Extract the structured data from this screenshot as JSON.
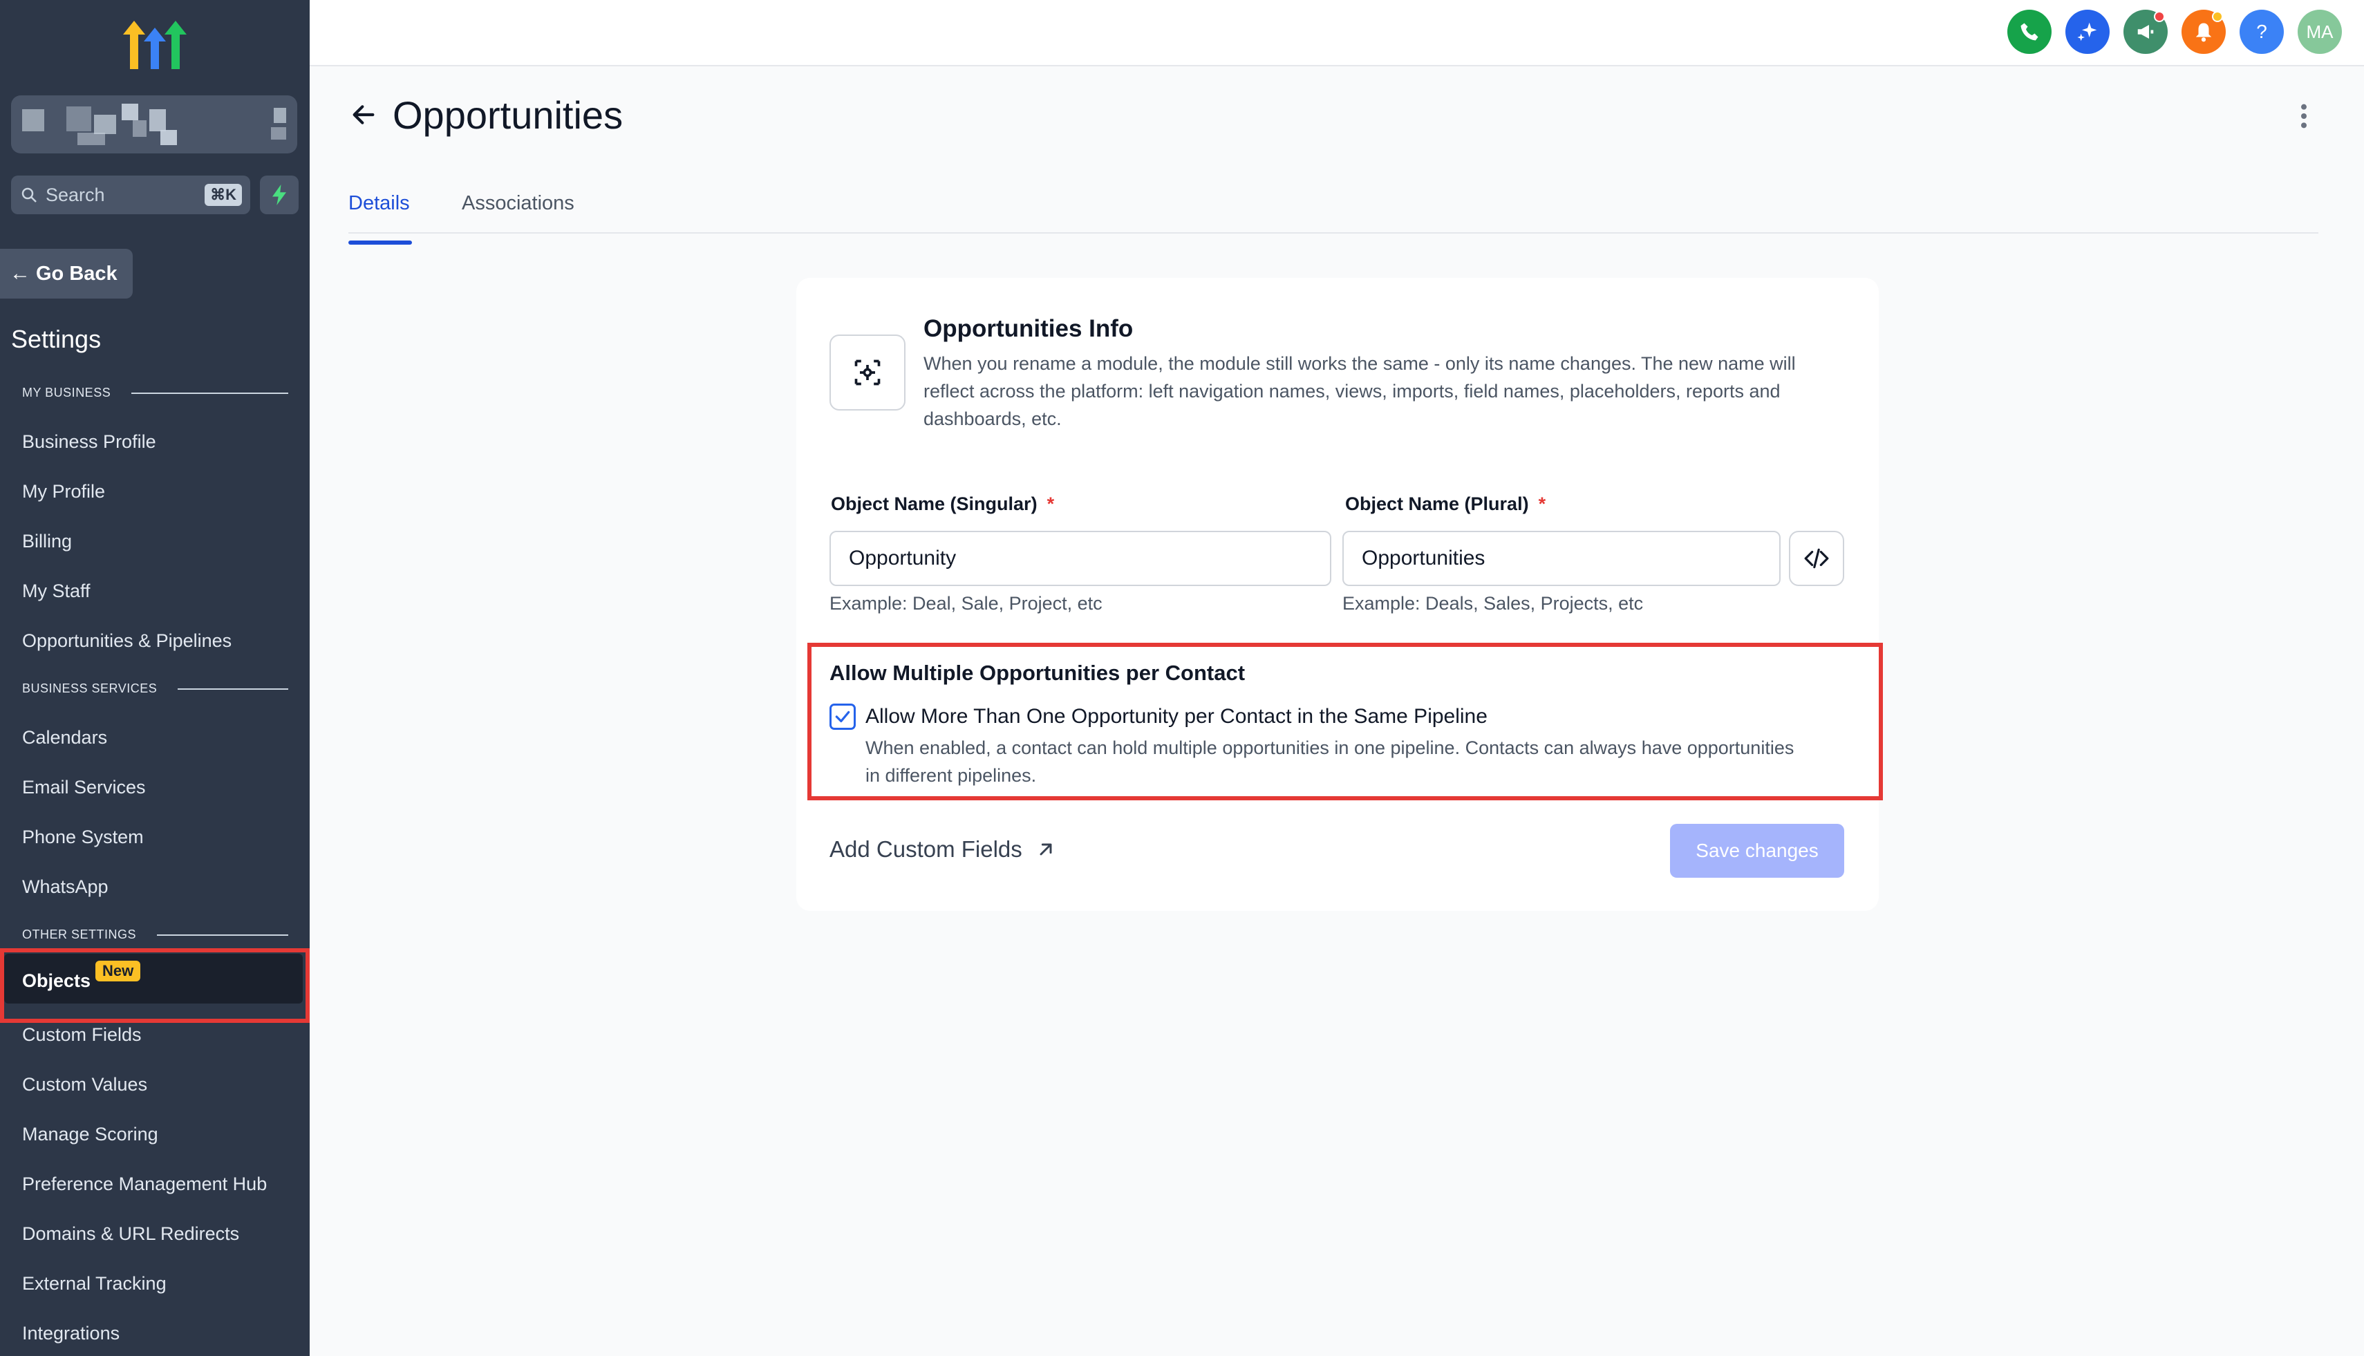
{
  "sidebar": {
    "search_label": "Search",
    "search_shortcut": "⌘K",
    "go_back": "Go Back",
    "settings_title": "Settings",
    "sections": [
      {
        "label": "MY BUSINESS"
      },
      {
        "label": "BUSINESS SERVICES"
      },
      {
        "label": "OTHER SETTINGS"
      }
    ],
    "items": [
      {
        "label": "Business Profile"
      },
      {
        "label": "My Profile"
      },
      {
        "label": "Billing"
      },
      {
        "label": "My Staff"
      },
      {
        "label": "Opportunities & Pipelines"
      },
      {
        "label": "Calendars"
      },
      {
        "label": "Email Services"
      },
      {
        "label": "Phone System"
      },
      {
        "label": "WhatsApp"
      },
      {
        "label": "Objects",
        "badge": "New",
        "active": true
      },
      {
        "label": "Custom Fields"
      },
      {
        "label": "Custom Values"
      },
      {
        "label": "Manage Scoring"
      },
      {
        "label": "Preference Management Hub"
      },
      {
        "label": "Domains & URL Redirects"
      },
      {
        "label": "External Tracking"
      },
      {
        "label": "Integrations"
      }
    ]
  },
  "topbar": {
    "icons": [
      {
        "name": "phone-icon",
        "color": "#16a34a"
      },
      {
        "name": "ai-sparkle-icon",
        "color": "#2563eb"
      },
      {
        "name": "megaphone-icon",
        "color": "#3f8f6b"
      },
      {
        "name": "bell-icon",
        "color": "#f97316"
      },
      {
        "name": "help-icon",
        "color": "#3b82f6",
        "glyph": "?"
      },
      {
        "name": "avatar",
        "color": "#86c89a",
        "initials": "MA"
      }
    ]
  },
  "page": {
    "title": "Opportunities",
    "tabs": [
      {
        "label": "Details",
        "active": true
      },
      {
        "label": "Associations"
      }
    ]
  },
  "card": {
    "info_title": "Opportunities Info",
    "info_desc": "When you rename a module, the module still works the same - only its name changes. The new name will reflect across the platform: left navigation names, views, imports, field names, placeholders, reports and dashboards, etc.",
    "singular_label": "Object Name (Singular)",
    "singular_value": "Opportunity",
    "singular_hint": "Example: Deal, Sale, Project, etc",
    "plural_label": "Object Name (Plural)",
    "plural_value": "Opportunities",
    "plural_hint": "Example: Deals, Sales, Projects, etc",
    "required_mark": "*",
    "multi_title": "Allow Multiple Opportunities per Contact",
    "multi_checkbox_label": "Allow More Than One Opportunity per Contact in the Same Pipeline",
    "multi_checked": true,
    "multi_desc": "When enabled, a contact can hold multiple opportunities in one pipeline. Contacts can always have opportunities in different pipelines.",
    "custom_fields_link": "Add Custom Fields",
    "save_button": "Save changes"
  },
  "colors": {
    "sidebar_bg": "#2d3748",
    "accent": "#1d4ed8",
    "highlight_red": "#e53935",
    "badge_yellow": "#fbbf24"
  }
}
